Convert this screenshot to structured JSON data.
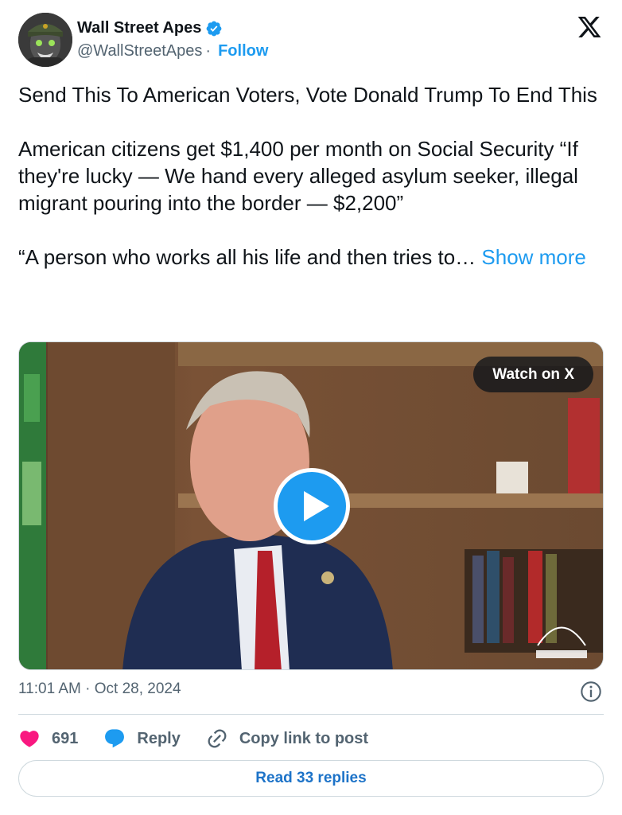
{
  "author": {
    "name": "Wall Street Apes",
    "handle": "@WallStreetApes",
    "separator": "·",
    "follow_label": "Follow",
    "verified": true,
    "avatar_icon": "gorilla-avatar-icon"
  },
  "tweet": {
    "text": "Send This To American Voters, Vote Donald Trump To End This\n\nAmerican citizens get $1,400 per month on Social Security “If they're lucky — We hand every alleged asylum seeker, illegal migrant pouring into the border — $2,200”\n\n“A person who works all his life and then tries to… ",
    "show_more_label": "Show more"
  },
  "media": {
    "watch_label": "Watch on X",
    "watermark": "THE TUCKER CARLSON ENCOUNTER"
  },
  "meta": {
    "time": "11:01 AM",
    "separator": "·",
    "date": "Oct 28, 2024"
  },
  "actions": {
    "likes": "691",
    "reply_label": "Reply",
    "copy_label": "Copy link to post"
  },
  "footer": {
    "read_replies_label": "Read 33 replies"
  },
  "colors": {
    "accent": "#1d9bf0",
    "heart": "#f91880",
    "text": "#0f1419",
    "muted": "#536471"
  }
}
